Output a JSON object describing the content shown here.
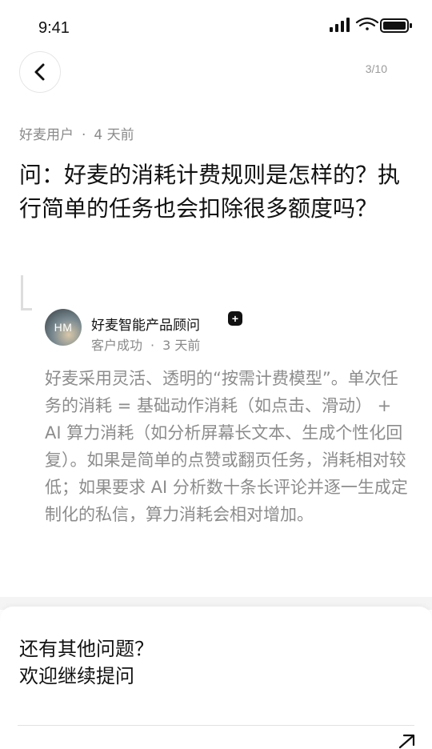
{
  "status_bar": {
    "time": "9:41",
    "icons": [
      "signal-icon",
      "wifi-icon",
      "battery-icon"
    ]
  },
  "header": {
    "back_icon": "chevron-left-icon",
    "page_indicator": "3/10"
  },
  "question": {
    "author": "好麦用户",
    "separator": "·",
    "time_ago": "4 天前",
    "text": "问：好麦的消耗计费规则是怎样的？执行简单的任务也会扣除很多额度吗？"
  },
  "answer": {
    "avatar_initials": "HM",
    "name": "好麦智能产品顾问",
    "badge": "+",
    "role": "客户成功",
    "separator": "·",
    "time_ago": "3 天前",
    "text": "好麦采用灵活、透明的“按需计费模型”。单次任务的消耗 = 基础动作消耗（如点击、滑动） + AI 算力消耗（如分析屏幕长文本、生成个性化回复）。如果是简单的点赞或翻页任务，消耗相对较低；如果要求 AI 分析数十条长评论并逐一生成定制化的私信，算力消耗会相对增加。"
  },
  "footer_card": {
    "line1": "还有其他问题？",
    "line2": "欢迎继续提问",
    "arrow_icon": "arrow-up-right-icon"
  }
}
